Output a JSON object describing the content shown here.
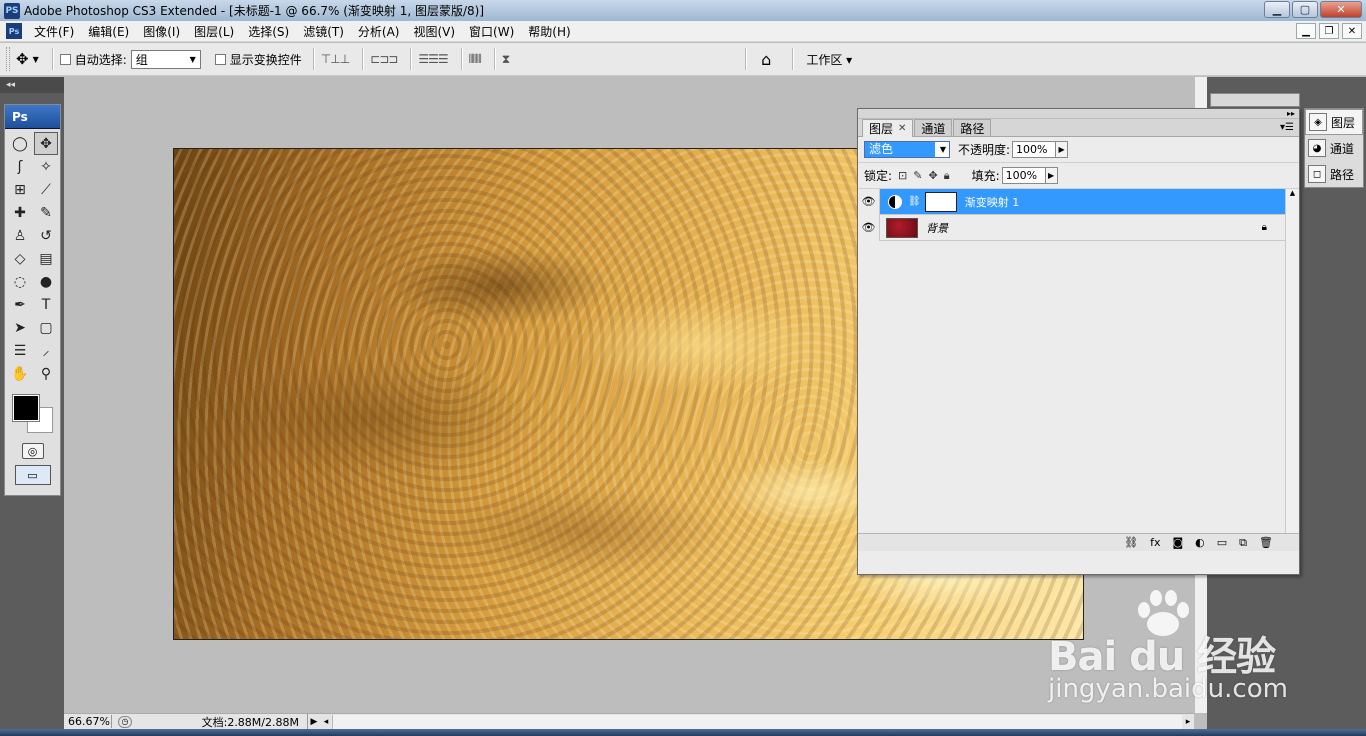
{
  "titlebar": {
    "app_icon": "PS",
    "title": "Adobe Photoshop CS3 Extended - [未标题-1 @ 66.7% (渐变映射 1, 图层蒙版/8)]",
    "minimize": "▁",
    "maximize": "▢",
    "close": "✕"
  },
  "menubar": {
    "app_icon": "Ps",
    "items": [
      "文件(F)",
      "编辑(E)",
      "图像(I)",
      "图层(L)",
      "选择(S)",
      "滤镜(T)",
      "分析(A)",
      "视图(V)",
      "窗口(W)",
      "帮助(H)"
    ],
    "doc_minimize": "▁",
    "doc_restore": "❐",
    "doc_close": "✕"
  },
  "options": {
    "auto_select_label": "自动选择:",
    "auto_select_value": "组",
    "show_transform_label": "显示变换控件",
    "workspace_label": "工作区 ▾"
  },
  "toolbox": {
    "header": "Ps",
    "tools": [
      {
        "name": "marquee-icon",
        "glyph": "◯"
      },
      {
        "name": "move-icon",
        "glyph": "✥"
      },
      {
        "name": "lasso-icon",
        "glyph": "ʃ"
      },
      {
        "name": "magic-wand-icon",
        "glyph": "✧"
      },
      {
        "name": "crop-icon",
        "glyph": "⊞"
      },
      {
        "name": "slice-icon",
        "glyph": "⟋"
      },
      {
        "name": "healing-icon",
        "glyph": "✚"
      },
      {
        "name": "brush-icon",
        "glyph": "✎"
      },
      {
        "name": "stamp-icon",
        "glyph": "♙"
      },
      {
        "name": "history-brush-icon",
        "glyph": "↺"
      },
      {
        "name": "eraser-icon",
        "glyph": "◇"
      },
      {
        "name": "gradient-icon",
        "glyph": "▤"
      },
      {
        "name": "blur-icon",
        "glyph": "◌"
      },
      {
        "name": "dodge-icon",
        "glyph": "●"
      },
      {
        "name": "pen-icon",
        "glyph": "✒"
      },
      {
        "name": "type-icon",
        "glyph": "T"
      },
      {
        "name": "path-select-icon",
        "glyph": "➤"
      },
      {
        "name": "shape-icon",
        "glyph": "▢"
      },
      {
        "name": "notes-icon",
        "glyph": "☰"
      },
      {
        "name": "eyedropper-icon",
        "glyph": "⸝"
      },
      {
        "name": "hand-icon",
        "glyph": "✋"
      },
      {
        "name": "zoom-icon",
        "glyph": "⚲"
      }
    ]
  },
  "colors": {
    "foreground": "#000000",
    "background": "#ffffff",
    "selection": "#3399ff"
  },
  "statusbar": {
    "zoom": "66.67%",
    "doc_info": "文档:2.88M/2.88M"
  },
  "layers_panel": {
    "tabs": [
      {
        "label": "图层",
        "active": true
      },
      {
        "label": "通道",
        "active": false
      },
      {
        "label": "路径",
        "active": false
      }
    ],
    "blend_mode": "滤色",
    "opacity_label": "不透明度:",
    "opacity_value": "100%",
    "lock_label": "锁定:",
    "fill_label": "填充:",
    "fill_value": "100%",
    "layers": [
      {
        "name": "渐变映射 1",
        "selected": true
      },
      {
        "name": "背景",
        "selected": false,
        "locked": true
      }
    ]
  },
  "right_dock": {
    "items": [
      {
        "label": "图层",
        "icon": "layers-icon"
      },
      {
        "label": "通道",
        "icon": "channels-icon"
      },
      {
        "label": "路径",
        "icon": "paths-icon"
      }
    ]
  },
  "watermark": {
    "brand": "Bai du 经验",
    "url": "jingyan.baidu.com"
  }
}
